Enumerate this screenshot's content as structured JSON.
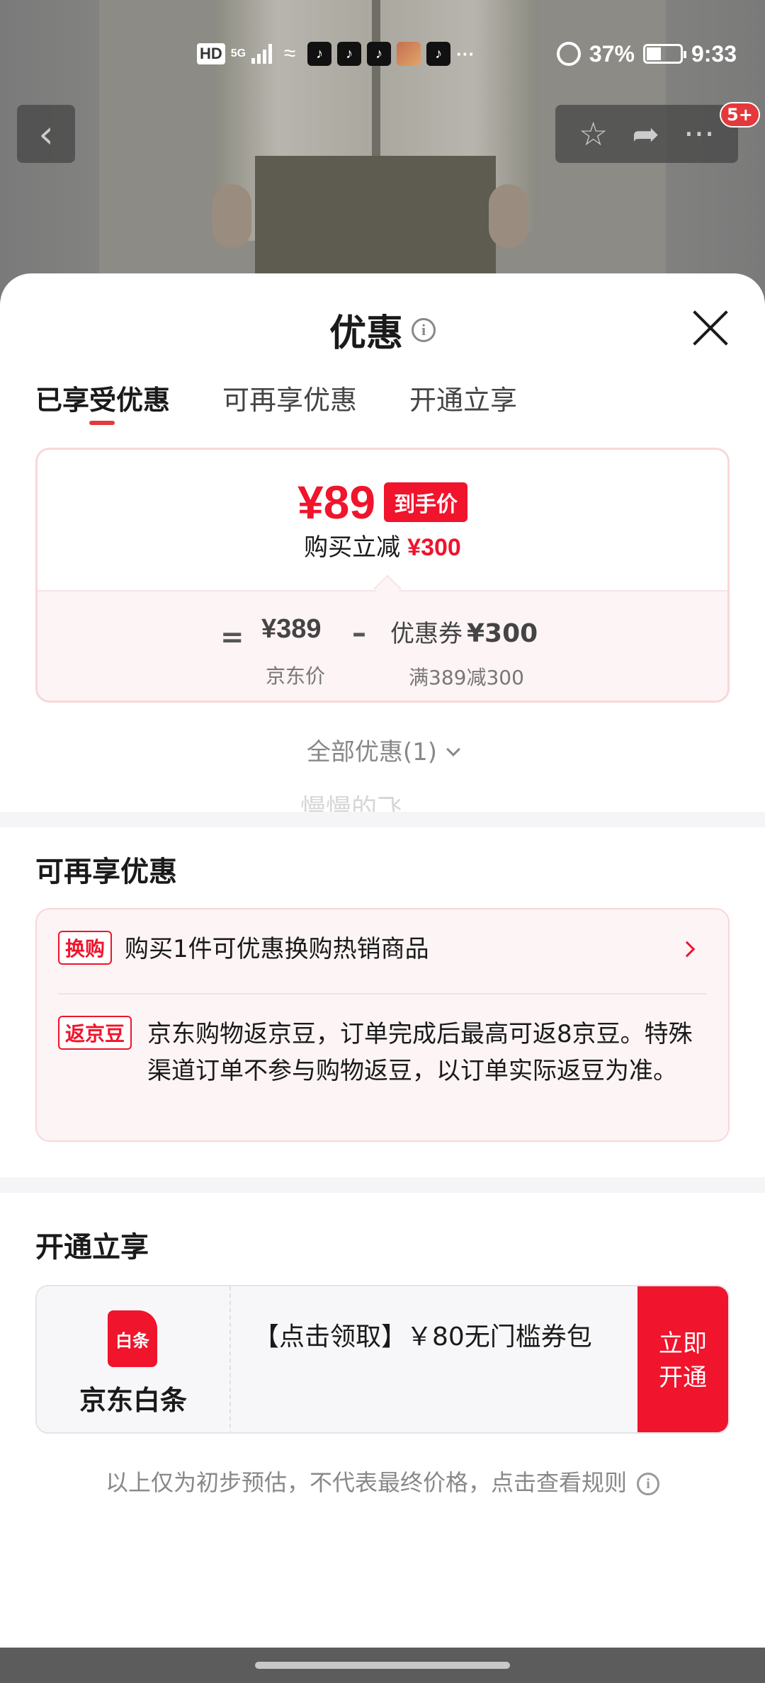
{
  "status_bar": {
    "hd": "HD",
    "network": "5G",
    "more": "···",
    "battery_pct": "37%",
    "time": "9:33",
    "icons": [
      "hd-icon",
      "signal-icon",
      "wifi-icon",
      "tiktok-icon",
      "tiktok-icon",
      "tiktok-icon",
      "photo-app-icon",
      "tiktok-icon",
      "alarm-icon",
      "battery-icon"
    ]
  },
  "nav": {
    "back_icon": "‹",
    "star_icon": "☆",
    "share_icon": "➦",
    "more_icon": "···",
    "badge": "5+"
  },
  "sheet": {
    "title": "优惠",
    "info_icon": "i",
    "tabs": [
      {
        "label": "已享受优惠",
        "active": true
      },
      {
        "label": "可再享优惠",
        "active": false
      },
      {
        "label": "开通立享",
        "active": false
      }
    ],
    "summary": {
      "final_price": "¥89",
      "final_price_tag": "到手价",
      "discount_label": "购买立减",
      "discount_amount": "¥300",
      "equals": "=",
      "jd_price": "¥389",
      "jd_price_label": "京东价",
      "minus": "–",
      "coupon_label": "优惠券",
      "coupon_amount": "¥300",
      "coupon_rule": "满389减300"
    },
    "all_offers": "全部优惠(1)",
    "watermark": "慢慢的飞",
    "more_section": {
      "title": "可再享优惠",
      "items": [
        {
          "tag": "换购",
          "text": "购买1件可优惠换购热销商品"
        },
        {
          "tag": "返京豆",
          "text": "京东购物返京豆，订单完成后最高可返8京豆。特殊渠道订单不参与购物返豆，以订单实际返豆为准。"
        }
      ]
    },
    "open_section": {
      "title": "开通立享",
      "logo_text": "白条",
      "product_name": "京东白条",
      "offer_text": "【点击领取】￥80无门槛券包",
      "button_label": "立即开通"
    },
    "footnote": "以上仅为初步预估，不代表最终价格，点击查看规则"
  },
  "colors": {
    "accent_red": "#f0142c",
    "tab_underline": "#e4393c",
    "card_border": "#f9d7d9",
    "card_bg_pink": "#fdf4f5"
  }
}
